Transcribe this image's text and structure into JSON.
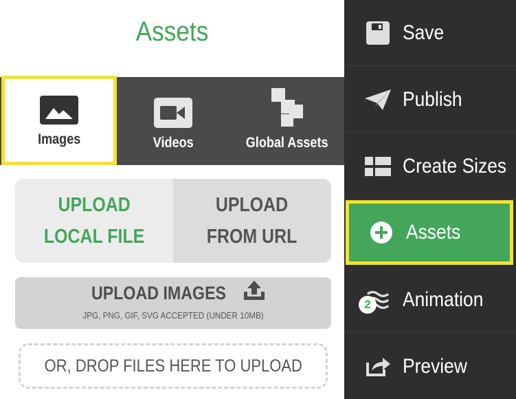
{
  "panel": {
    "title": "Assets",
    "tabs": [
      {
        "label": "Images",
        "icon": "image-icon",
        "selected": true
      },
      {
        "label": "Videos",
        "icon": "video-camera-icon",
        "selected": false
      },
      {
        "label": "Global Assets",
        "icon": "global-assets-icon",
        "selected": false
      }
    ],
    "source_options": [
      {
        "label": "UPLOAD\nLOCAL FILE",
        "selected": true
      },
      {
        "label": "UPLOAD\nFROM URL",
        "selected": false
      }
    ],
    "upload_button": {
      "label": "UPLOAD IMAGES",
      "sublabel": "JPG, PNG, GIF, SVG ACCEPTED (UNDER 10MB)",
      "icon": "upload-icon"
    },
    "drop_zone": {
      "label": "OR, DROP FILES HERE TO UPLOAD"
    }
  },
  "sidebar": {
    "items": [
      {
        "label": "Save",
        "icon": "floppy-disk-icon"
      },
      {
        "label": "Publish",
        "icon": "paper-plane-icon"
      },
      {
        "label": "Create Sizes",
        "icon": "grid-icon"
      },
      {
        "label": "Assets",
        "icon": "plus-circle-icon",
        "active": true
      },
      {
        "label": "Animation",
        "icon": "waves-icon",
        "badge": "2"
      },
      {
        "label": "Preview",
        "icon": "share-arrow-icon"
      }
    ]
  },
  "colors": {
    "accent_green": "#43a65a",
    "highlight_yellow": "#f5e32a",
    "sidebar_bg": "#2e2e2e",
    "tabs_bg": "#4a4a4a"
  }
}
